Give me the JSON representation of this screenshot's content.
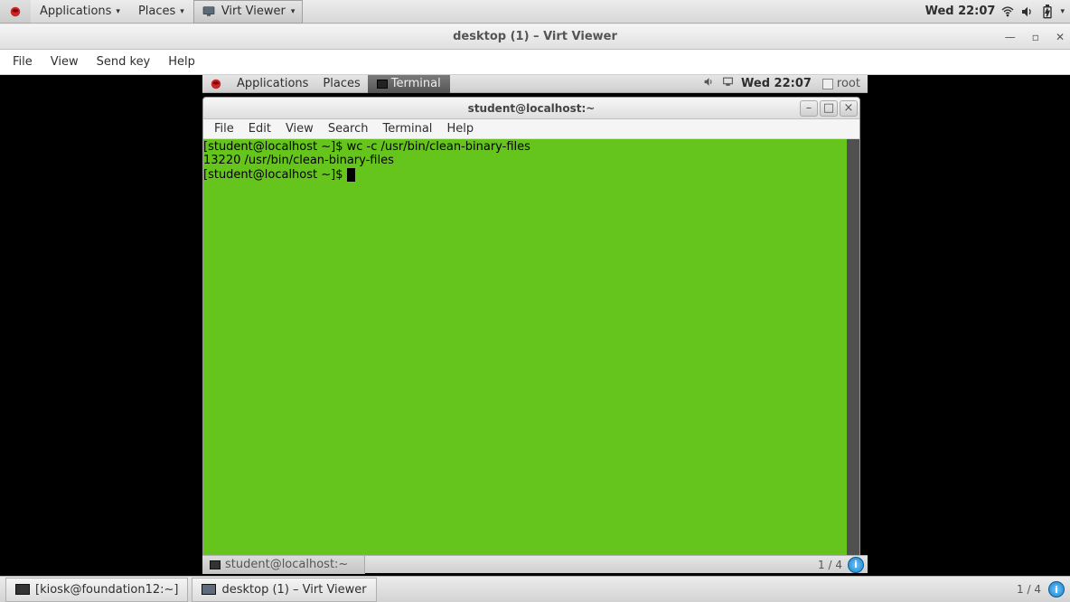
{
  "outer_panel": {
    "applications": "Applications",
    "places": "Places",
    "running_app": "Virt Viewer",
    "clock": "Wed 22:07"
  },
  "virt_viewer": {
    "title": "desktop (1) – Virt Viewer",
    "menu": {
      "file": "File",
      "view": "View",
      "sendkey": "Send key",
      "help": "Help"
    },
    "controls": {
      "min": "—",
      "max": "▫",
      "close": "✕"
    }
  },
  "guest_panel": {
    "applications": "Applications",
    "places": "Places",
    "task_terminal": "Terminal",
    "clock": "Wed 22:07",
    "user": "root"
  },
  "terminal": {
    "title": "student@localhost:~",
    "menu": {
      "file": "File",
      "edit": "Edit",
      "view": "View",
      "search": "Search",
      "terminal": "Terminal",
      "help": "Help"
    },
    "controls": {
      "min": "–",
      "max": "□",
      "close": "×"
    },
    "lines": {
      "l1": "[student@localhost ~]$ wc -c /usr/bin/clean-binary-files",
      "l2": "13220 /usr/bin/clean-binary-files",
      "l3": "[student@localhost ~]$ "
    }
  },
  "guest_bottom": {
    "task_label": "student@localhost:~",
    "ws": "1 / 4"
  },
  "outer_bottom": {
    "task1": "[kiosk@foundation12:~]",
    "task2": "desktop (1) – Virt Viewer",
    "ws": "1 / 4"
  }
}
